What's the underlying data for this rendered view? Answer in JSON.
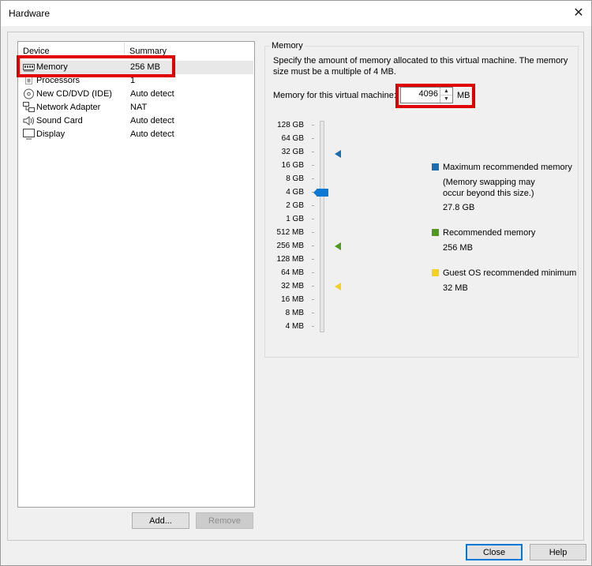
{
  "window": {
    "title": "Hardware"
  },
  "device_list": {
    "col_device": "Device",
    "col_summary": "Summary",
    "rows": [
      {
        "name": "Memory",
        "summary": "256 MB",
        "icon": "memory-icon"
      },
      {
        "name": "Processors",
        "summary": "1",
        "icon": "processor-icon"
      },
      {
        "name": "New CD/DVD (IDE)",
        "summary": "Auto detect",
        "icon": "cd-dvd-icon"
      },
      {
        "name": "Network Adapter",
        "summary": "NAT",
        "icon": "network-icon"
      },
      {
        "name": "Sound Card",
        "summary": "Auto detect",
        "icon": "speaker-icon"
      },
      {
        "name": "Display",
        "summary": "Auto detect",
        "icon": "monitor-icon"
      }
    ],
    "selected": "Memory",
    "add_label": "Add...",
    "remove_label": "Remove"
  },
  "memory": {
    "group_label": "Memory",
    "description": "Specify the amount of memory allocated to this virtual machine. The memory size must be a multiple of 4 MB.",
    "field_label": "Memory for this virtual machine:",
    "value": "4096",
    "unit": "MB",
    "scale": [
      "128 GB",
      "64 GB",
      "32 GB",
      "16 GB",
      "8 GB",
      "4 GB",
      "2 GB",
      "1 GB",
      "512 MB",
      "256 MB",
      "128 MB",
      "64 MB",
      "32 MB",
      "16 MB",
      "8 MB",
      "4 MB"
    ],
    "slider_value": "4 GB",
    "legend": {
      "max_title": "Maximum recommended memory",
      "max_note": "(Memory swapping may occur beyond this size.)",
      "max_value": "27.8 GB",
      "rec_title": "Recommended memory",
      "rec_value": "256 MB",
      "min_title": "Guest OS recommended minimum",
      "min_value": "32 MB"
    },
    "colors": {
      "max": "#1a6fb3",
      "rec": "#4f9a1d",
      "min": "#f4d21f",
      "slider": "#0a7ad4",
      "highlight": "#e10000"
    }
  },
  "footer": {
    "close_label": "Close",
    "help_label": "Help"
  }
}
